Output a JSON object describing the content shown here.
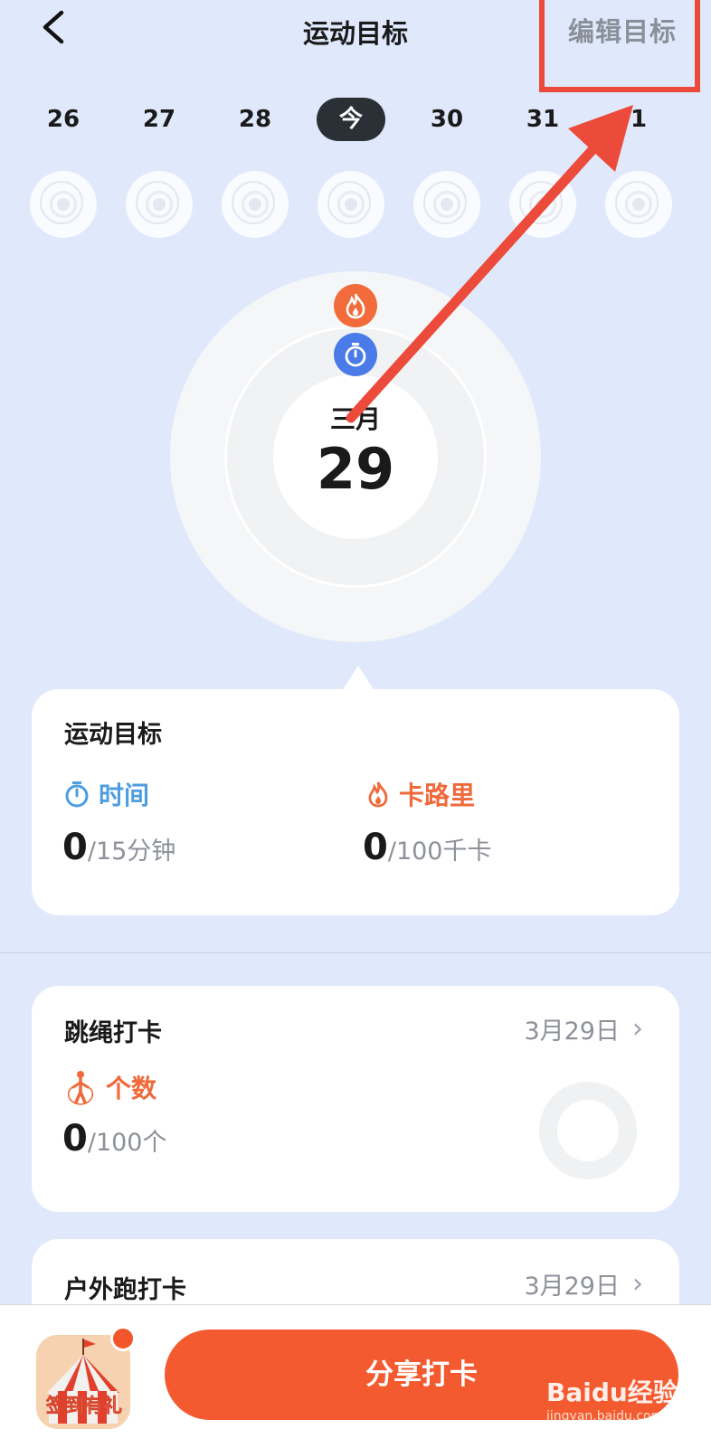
{
  "header": {
    "title": "运动目标",
    "edit_label": "编辑目标"
  },
  "dates": [
    {
      "label": "26",
      "today": false
    },
    {
      "label": "27",
      "today": false
    },
    {
      "label": "28",
      "today": false
    },
    {
      "label": "今",
      "today": true
    },
    {
      "label": "30",
      "today": false
    },
    {
      "label": "31",
      "today": false
    },
    {
      "label": "1",
      "today": false
    }
  ],
  "dial": {
    "month": "三月",
    "day": "29"
  },
  "goal_card": {
    "title": "运动目标",
    "time": {
      "label": "时间",
      "value": "0",
      "target": "/15分钟"
    },
    "calories": {
      "label": "卡路里",
      "value": "0",
      "target": "/100千卡"
    }
  },
  "rope_card": {
    "title": "跳绳打卡",
    "date": "3月29日",
    "chevron": "›",
    "metric": {
      "label": "个数",
      "value": "0",
      "target": "/100个"
    },
    "progress": 0
  },
  "run_card": {
    "title": "户外跑打卡",
    "date": "3月29日",
    "chevron": "›"
  },
  "bottom": {
    "gift_label": "签到有礼",
    "share_label": "分享打卡"
  },
  "watermark": {
    "brand": "Baidu经验",
    "url": "jingyan.baidu.com"
  },
  "colors": {
    "accent": "#f45a2f",
    "time_blue": "#4a7be8",
    "annot_red": "#ec4b3c",
    "background": "#dfe9fb"
  },
  "icons": [
    "back-chevron-icon",
    "fire-icon",
    "stopwatch-icon",
    "jump-rope-icon",
    "chevron-right-icon",
    "circus-tent-icon"
  ]
}
